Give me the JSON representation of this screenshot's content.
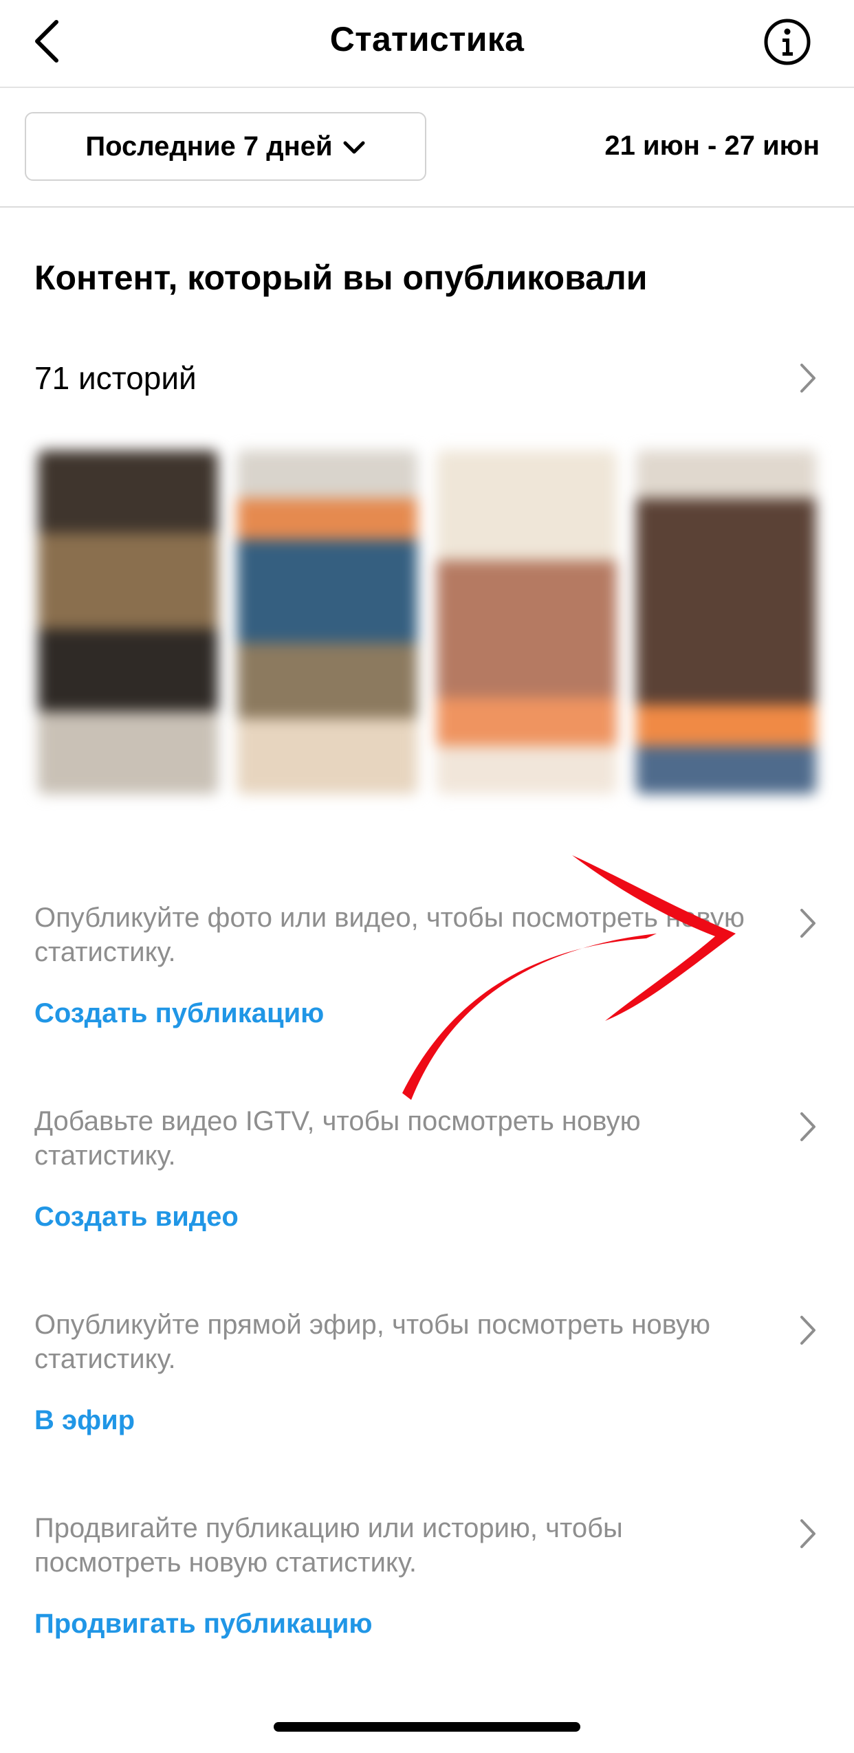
{
  "nav": {
    "title": "Статистика",
    "back_icon": "chevron-left-icon",
    "info_icon": "info-icon"
  },
  "filter": {
    "range_label": "Последние 7 дней",
    "range_icon": "chevron-down-icon",
    "date_range": "21 июн - 27 июн"
  },
  "content": {
    "title": "Контент, который вы опубликовали",
    "stories_count": "71 историй"
  },
  "prompts": [
    {
      "text": "Опубликуйте фото или видео, чтобы посмотреть новую статистику.",
      "link": "Создать публикацию"
    },
    {
      "text": "Добавьте видео IGTV, чтобы посмотреть новую статистику.",
      "link": "Создать видео"
    },
    {
      "text": "Опубликуйте прямой эфир, чтобы посмотреть новую статистику.",
      "link": "В эфир"
    },
    {
      "text": "Продвигайте публикацию или историю, чтобы посмотреть новую статистику.",
      "link": "Продвигать публикацию"
    }
  ],
  "colors": {
    "link": "#2096e6",
    "secondary_text": "#8e8e8e",
    "annotation": "#ee0a16"
  }
}
